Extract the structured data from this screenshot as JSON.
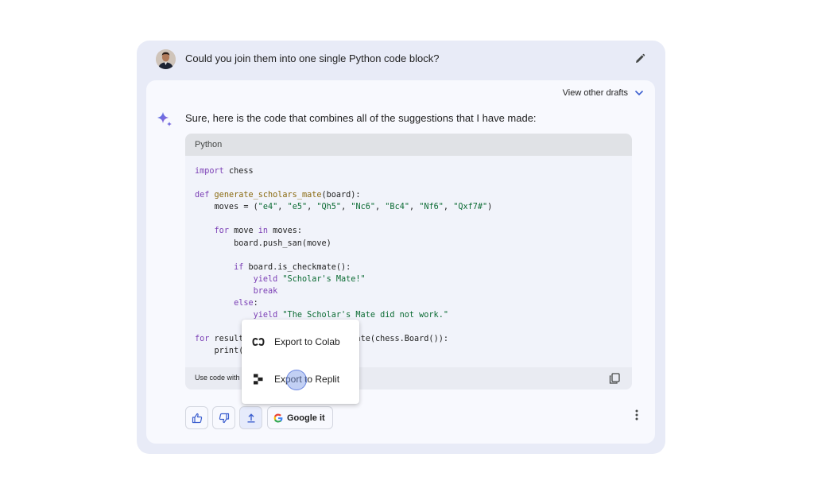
{
  "prompt": {
    "text": "Could you join them into one single Python code block?"
  },
  "response": {
    "view_drafts_label": "View other drafts",
    "answer_text": "Sure, here is the code that combines all of the suggestions that I have made:"
  },
  "code_block": {
    "language": "Python",
    "lines": [
      "import chess",
      "",
      "def generate_scholars_mate(board):",
      "    moves = (\"e4\", \"e5\", \"Qh5\", \"Nc6\", \"Bc4\", \"Nf6\", \"Qxf7#\")",
      "",
      "    for move in moves:",
      "        board.push_san(move)",
      "",
      "        if board.is_checkmate():",
      "            yield \"Scholar's Mate!\"",
      "            break",
      "        else:",
      "            yield \"The Scholar's Mate did not work.\"",
      "",
      "for result in generate_scholars_mate(chess.Board()):",
      "    print(result)"
    ],
    "footer_text": "Use code with caution."
  },
  "actions": {
    "google_it_label": "Google it"
  },
  "export_menu": {
    "items": [
      {
        "label": "Export to Colab",
        "icon": "colab-icon"
      },
      {
        "label": "Export to Replit",
        "icon": "replit-icon"
      }
    ]
  },
  "colors": {
    "outer_bg": "#e8ebf7",
    "inner_bg": "#f8f9fe",
    "code_header_bg": "#e0e2e6",
    "keyword": "#7b3fb5",
    "function": "#8a6a10",
    "string": "#0b6b33",
    "accent_blue": "#4285f4"
  }
}
